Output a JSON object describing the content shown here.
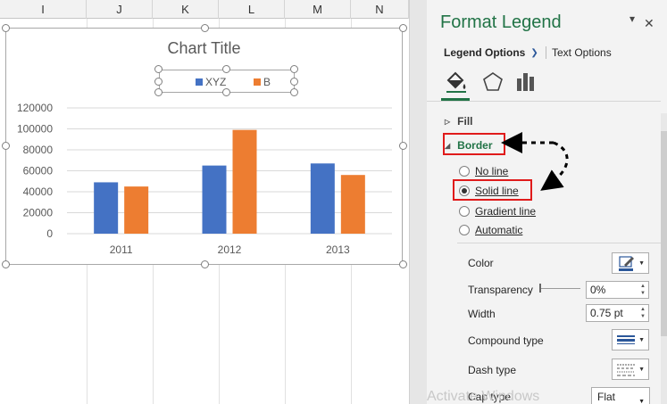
{
  "sheet": {
    "columns": [
      "I",
      "J",
      "K",
      "L",
      "M",
      "N"
    ]
  },
  "chart": {
    "title": "Chart Title",
    "legend": [
      "XYZ",
      "B"
    ]
  },
  "chart_data": {
    "type": "bar",
    "title": "Chart Title",
    "categories": [
      "2011",
      "2012",
      "2013"
    ],
    "series": [
      {
        "name": "XYZ",
        "values": [
          49000,
          65000,
          67000
        ],
        "color": "#4472c4"
      },
      {
        "name": "B",
        "values": [
          45000,
          99000,
          56000
        ],
        "color": "#ed7d31"
      }
    ],
    "yticks": [
      "0",
      "20000",
      "40000",
      "60000",
      "80000",
      "100000",
      "120000"
    ],
    "ylim": [
      0,
      120000
    ],
    "legend_position": "top",
    "grid": true
  },
  "pane": {
    "title": "Format Legend",
    "tabs": {
      "legend_options": "Legend Options",
      "text_options": "Text Options"
    },
    "icons": [
      "paint-bucket-icon",
      "pentagon-icon",
      "bar-chart-icon"
    ],
    "sections": {
      "fill": "Fill",
      "border": "Border"
    },
    "radios": [
      {
        "label": "No line",
        "selected": false
      },
      {
        "label": "Solid line",
        "selected": true
      },
      {
        "label": "Gradient line",
        "selected": false
      },
      {
        "label": "Automatic",
        "selected": false
      }
    ],
    "props": {
      "color": "Color",
      "transparency": "Transparency",
      "transparency_value": "0%",
      "width": "Width",
      "width_value": "0.75 pt",
      "compound_type": "Compound type",
      "dash_type": "Dash type",
      "cap_type": "Cap type",
      "cap_type_value": "Flat"
    },
    "accent": "#217346",
    "watermark": "Activate Windows"
  }
}
